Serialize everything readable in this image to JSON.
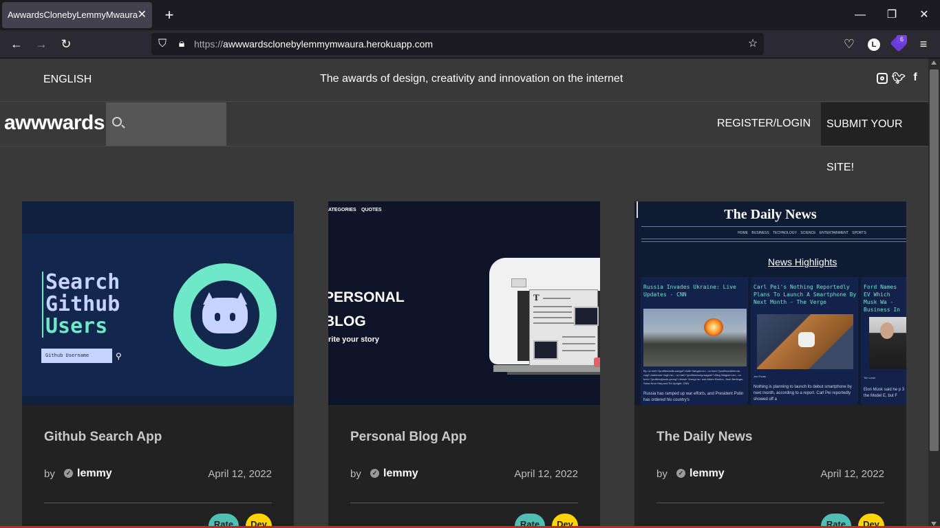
{
  "browser": {
    "tab_title": "AwwardsClonebyLemmyMwaura",
    "tab_close": "✕",
    "new_tab": "+",
    "url_protocol": "https://",
    "url_host": "awwwardsclonebylemmymwaura.herokuapp.com",
    "account_initial": "L",
    "extension_badge": "6",
    "window_min": "—",
    "window_max": "❐",
    "window_close": "✕"
  },
  "topbar": {
    "language": "ENGLISH",
    "tagline": "The awards of design, creativity and innovation on the internet",
    "social": [
      "instagram-icon",
      "twitter-icon",
      "facebook-icon"
    ]
  },
  "header": {
    "logo": "awwwards.",
    "register_login": "REGISTER/LOGIN",
    "submit_site": "SUBMIT YOUR SITE!"
  },
  "projects": [
    {
      "title": "Github Search App",
      "by": "by",
      "author": "lemmy",
      "date": "April 12, 2022",
      "tags": [
        "Rate",
        "Dev"
      ],
      "thumb": {
        "line1": "Search",
        "line2": "Github",
        "line3": "Users",
        "input_placeholder": "Github Username"
      }
    },
    {
      "title": "Personal Blog App",
      "by": "by",
      "author": "lemmy",
      "date": "April 12, 2022",
      "tags": [
        "Rate",
        "Dev"
      ],
      "thumb": {
        "nav1": "ATEGORIES",
        "nav2": "QUOTES",
        "heading1": "PERSONAL",
        "heading2": "BLOG",
        "subheading": "rite your story",
        "paper_letter": "T"
      }
    },
    {
      "title": "The Daily News",
      "by": "by",
      "author": "lemmy",
      "date": "April 12, 2022",
      "tags": [
        "Rate",
        "Dev"
      ],
      "thumb": {
        "masthead": "The Daily News",
        "menu": "HOME BUSINESS TECHNOLOGY SCIENCE ENTERTAINMENT SPORTS",
        "section": "News Highlights",
        "articles": [
          {
            "title": "Russia Invades Ukraine: Live Updates - CNN",
            "byline": "By <a href=\"/profiles/aditi-sangal\">Aditi Sangal</a>, <a href=\"/profiles/adrienne-vogt\">Adrienne Vogt</a>, <a href=\"/profiles/meg-wagner\">Meg Wagner</a>, <a href=\"/profiles/jessie-yeung\">Jessie Yeung</a> and Adam Renton, Josh Berlinger, Sana Noor Haq and Ed Upright, CNN",
            "text": "Russia has ramped up war efforts, and President Putin has ordered his country's"
          },
          {
            "title": "Carl Pei's Nothing Reportedly Plans To Launch A Smartphone By Next Month - The Verge",
            "byline": "Jon Porter",
            "text": "Nothing is planning to launch its debut smartphone by next month, according to a report. Carl Pei reportedly showed off a"
          },
          {
            "title": "Ford Names EV Which Musk Wa - Business In",
            "byline": "Tim Levin",
            "text": "Elon Musk said he p 3 the Model E, but F"
          }
        ]
      }
    }
  ]
}
